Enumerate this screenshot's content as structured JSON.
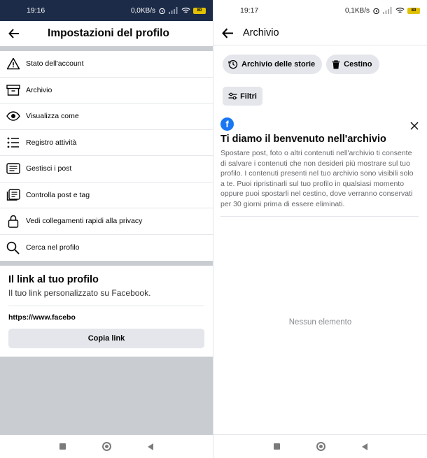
{
  "left": {
    "status": {
      "time": "19:16",
      "speed": "0,0KB/s",
      "battery": "80"
    },
    "header": {
      "title": "Impostazioni del profilo"
    },
    "menu": [
      {
        "label": "Stato dell'account",
        "icon": "warning-icon"
      },
      {
        "label": "Archivio",
        "icon": "archive-icon"
      },
      {
        "label": "Visualizza come",
        "icon": "eye-icon"
      },
      {
        "label": "Registro attività",
        "icon": "list-icon"
      },
      {
        "label": "Gestisci i post",
        "icon": "posts-icon"
      },
      {
        "label": "Controlla post e tag",
        "icon": "review-posts-icon"
      },
      {
        "label": "Vedi collegamenti rapidi alla privacy",
        "icon": "lock-icon"
      },
      {
        "label": "Cerca nel profilo",
        "icon": "search-icon"
      }
    ],
    "link_card": {
      "title": "Il link al tuo profilo",
      "subtitle": "Il tuo link personalizzato su Facebook.",
      "url": "https://www.faceboo",
      "copy_label": "Copia link"
    }
  },
  "right": {
    "status": {
      "time": "19:17",
      "speed": "0,1KB/s",
      "battery": "80"
    },
    "header": {
      "title": "Archivio"
    },
    "chips": [
      {
        "label": "Archivio delle storie",
        "icon": "history-icon"
      },
      {
        "label": "Cestino",
        "icon": "trash-icon"
      }
    ],
    "filter_label": "Filtri",
    "welcome": {
      "title": "Ti diamo il benvenuto nell'archivio",
      "body": "Spostare post, foto o altri contenuti nell'archivio ti consente di salvare i contenuti che non desideri più mostrare sul tuo profilo. I contenuti presenti nel tuo archivio sono visibili solo a te. Puoi ripristinarli sul tuo profilo in qualsiasi momento oppure puoi spostarli nel cestino, dove verranno conservati per 30 giorni prima di essere eliminati."
    },
    "empty_label": "Nessun elemento"
  },
  "colors": {
    "status_bar_dark": "#1c2b48",
    "facebook_blue": "#1877f2",
    "chip_bg": "#e4e6eb",
    "separator_gray": "#c9ccd1"
  }
}
